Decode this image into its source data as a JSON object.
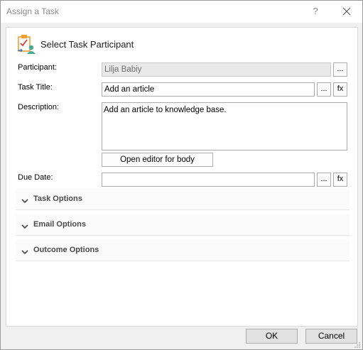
{
  "window": {
    "title": "Assign a Task",
    "help_glyph": "?",
    "close_icon": "close-icon"
  },
  "header": {
    "text": "Select Task Participant",
    "icon": "task-participant-icon"
  },
  "form": {
    "participant_label": "Participant:",
    "participant_value": "Lilja Babiy",
    "task_title_label": "Task Title:",
    "task_title_value": "Add an article",
    "description_label": "Description:",
    "description_value": "Add an article to knowledge base.",
    "open_editor_label": "Open editor for body",
    "due_date_label": "Due Date:",
    "due_date_value": "",
    "ellipsis_label": "...",
    "fx_label": "fx"
  },
  "sections": [
    {
      "label": "Task Options",
      "expanded": false
    },
    {
      "label": "Email Options",
      "expanded": false
    },
    {
      "label": "Outcome Options",
      "expanded": false
    }
  ],
  "footer": {
    "ok_label": "OK",
    "cancel_label": "Cancel"
  },
  "colors": {
    "icon_orange": "#f0a030",
    "icon_red": "#d83b3b",
    "icon_teal": "#4aa89a",
    "icon_blue": "#3b78c8"
  }
}
